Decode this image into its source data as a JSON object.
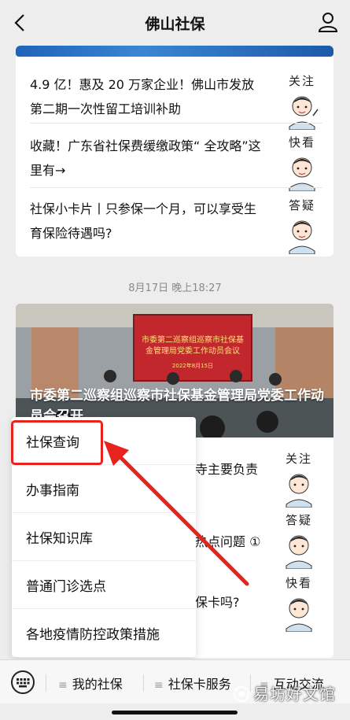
{
  "header": {
    "title": "佛山社保",
    "back_icon": "chevron-left-icon",
    "profile_icon": "person-icon"
  },
  "card1": {
    "items": [
      {
        "text": "4.9 亿！惠及 20 万家企业！佛山市发放第二期一次性留工培训补助",
        "tag": "关注"
      },
      {
        "text": "收藏！广东省社保费缓缴政策“ 全攻略”这里有→",
        "tag": "快看"
      },
      {
        "text": "社保小卡片丨只参保一个月，可以享受生育保险待遇吗?",
        "tag": "答疑"
      }
    ]
  },
  "timestamp": "8月17日 晚上18:27",
  "card2": {
    "photo_banner": "市委第二巡察组巡察市社保基金管理局党委工作动员会议",
    "photo_date": "2022年8月15日",
    "headline": "市委第二巡察组巡察市社保基金管理局党委工作动员会召开",
    "partials": [
      "寺主要负责",
      "热点问题 ①",
      "保卡吗?"
    ],
    "tags": [
      "关注",
      "答疑",
      "快看"
    ]
  },
  "menu": {
    "items": [
      "社保查询",
      "办事指南",
      "社保知识库",
      "普通门诊选点",
      "各地疫情防控政策措施"
    ],
    "highlight_color": "#e8231e"
  },
  "bottombar": {
    "items": [
      "我的社保",
      "社保卡服务",
      "互动交流"
    ],
    "keyboard_icon": "keyboard-icon"
  },
  "watermark": "易坊好文馆"
}
